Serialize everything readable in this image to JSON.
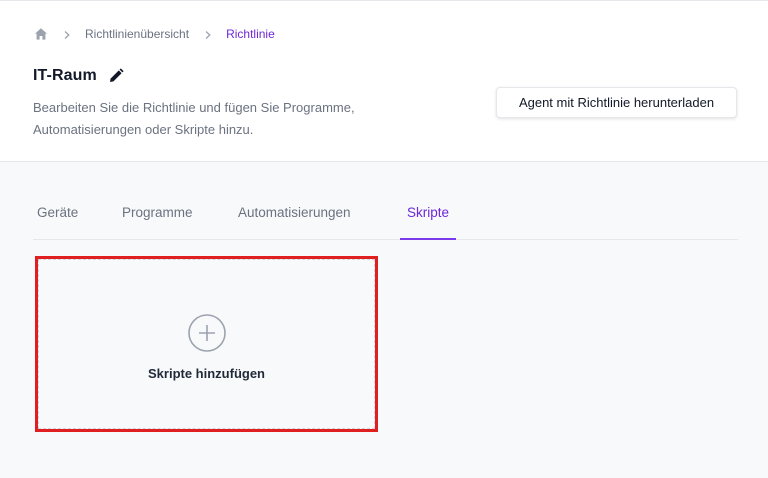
{
  "breadcrumb": {
    "home_icon": "home-icon",
    "items": [
      "Richtlinienübersicht",
      "Richtlinie"
    ]
  },
  "header": {
    "title": "IT-Raum",
    "edit_icon": "pencil-icon",
    "description": "Bearbeiten Sie die Richtlinie und fügen Sie Programme, Automatisierungen oder Skripte hinzu.",
    "download_button": "Agent mit Richtlinie herunterladen"
  },
  "tabs": [
    {
      "label": "Geräte",
      "active": false
    },
    {
      "label": "Programme",
      "active": false
    },
    {
      "label": "Automatisierungen",
      "active": false
    },
    {
      "label": "Skripte",
      "active": true
    }
  ],
  "content": {
    "add_card_icon": "plus-circle-icon",
    "add_card_label": "Skripte hinzufügen"
  },
  "colors": {
    "accent": "#6d28d9",
    "highlight_border": "#e02020",
    "muted_text": "#6b7280"
  }
}
